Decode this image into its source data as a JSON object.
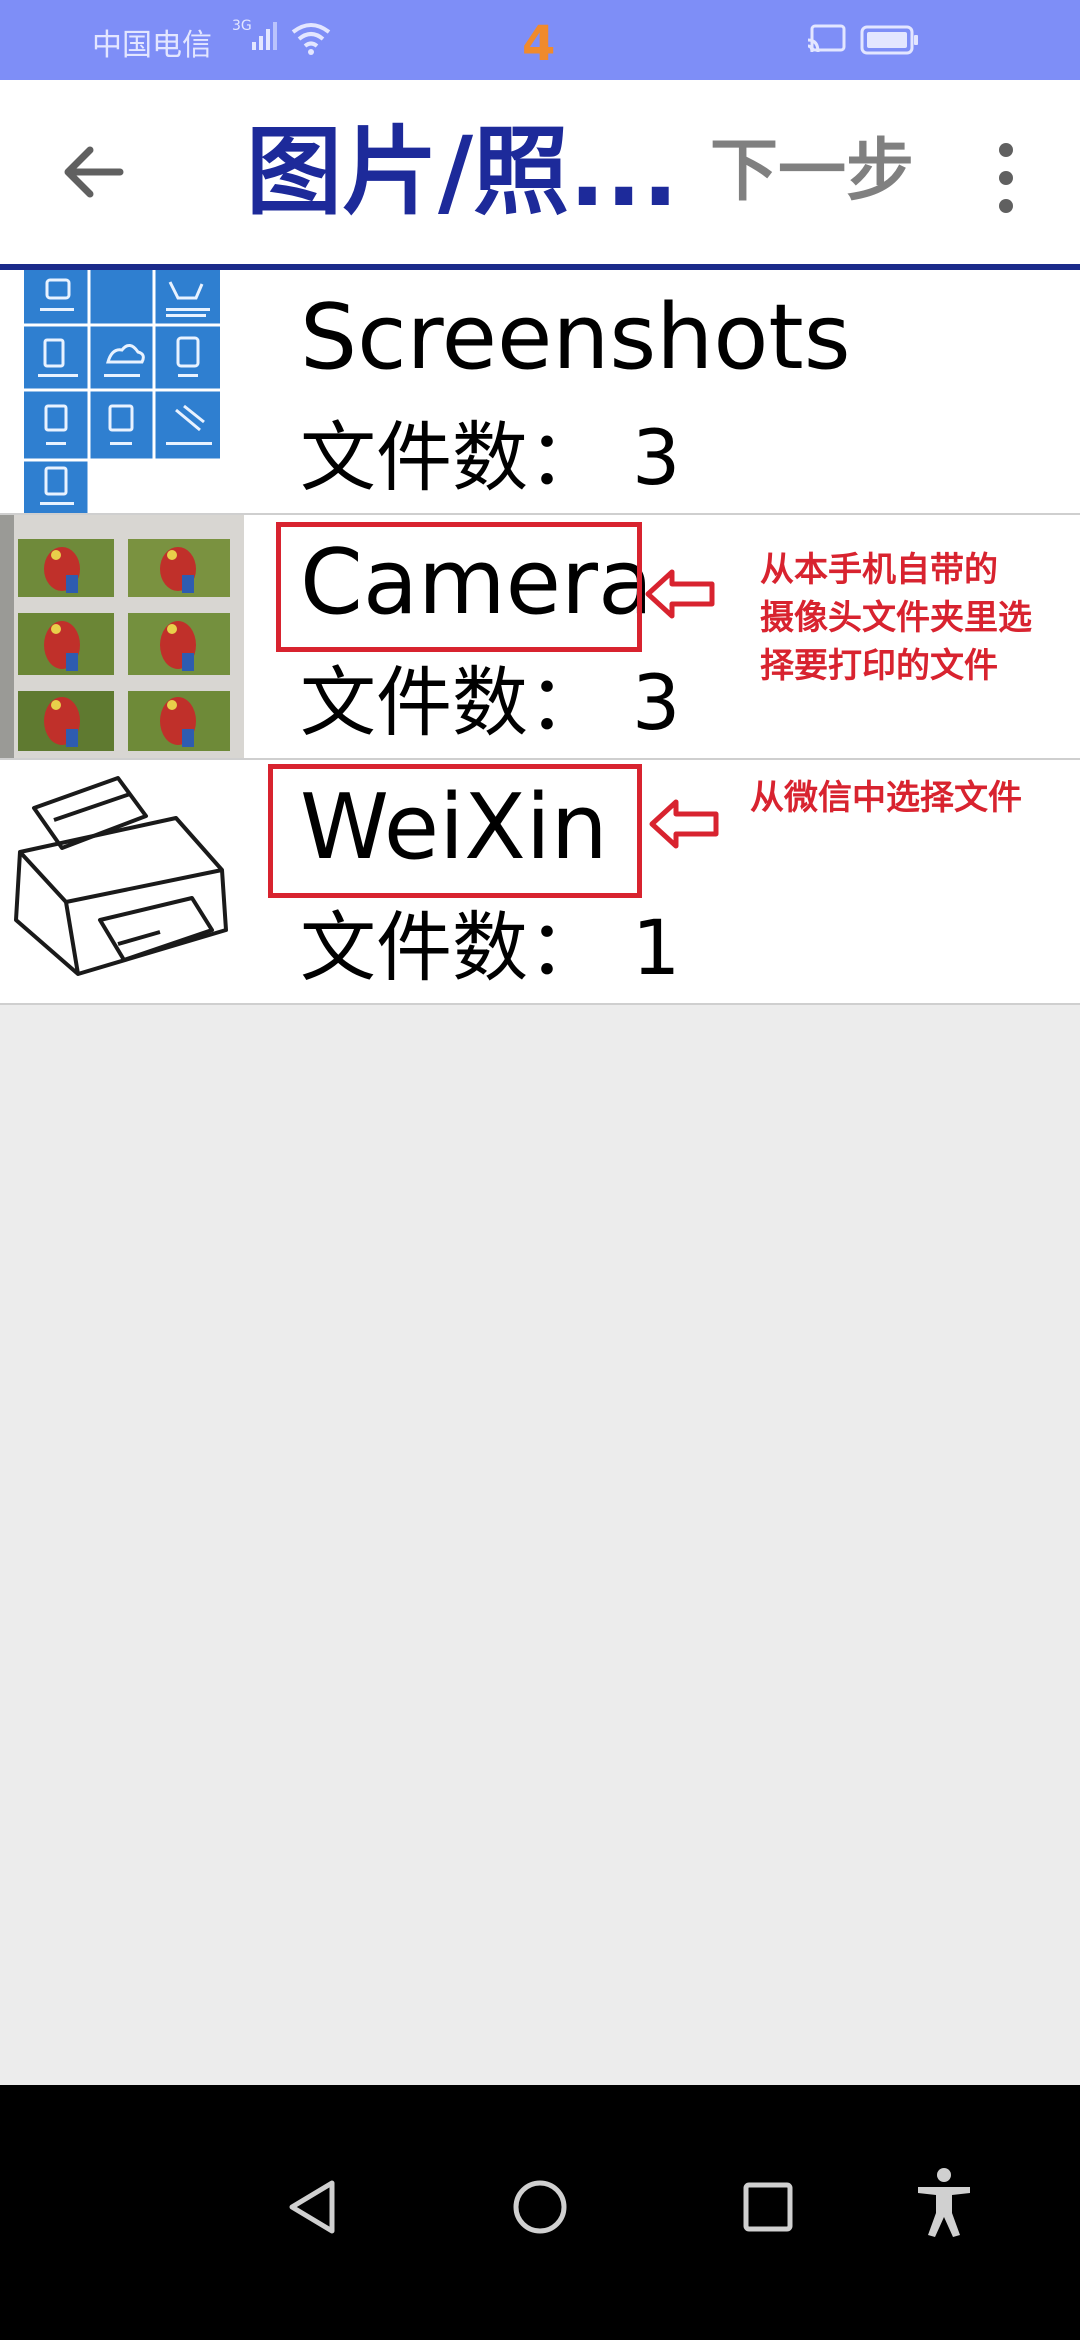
{
  "status_bar": {
    "carrier": "中国电信",
    "network": "3G",
    "step_number": "4",
    "icons": [
      "signal-icon",
      "wifi-icon",
      "cast-icon",
      "battery-icon"
    ]
  },
  "app_bar": {
    "back_icon": "arrow-left-icon",
    "title": "图片/照...",
    "next_label": "下一步",
    "more_icon": "more-vertical-icon"
  },
  "folders": [
    {
      "name": "Screenshots",
      "count_label": "文件数：",
      "count": "3",
      "thumbnail": "screenshot-grid"
    },
    {
      "name": "Camera",
      "count_label": "文件数：",
      "count": "3",
      "thumbnail": "parrot-photos"
    },
    {
      "name": "WeiXin",
      "count_label": "文件数：",
      "count": "1",
      "thumbnail": "printer-drawing"
    }
  ],
  "annotations": {
    "camera_note": [
      "从本手机自带的",
      "摄像头文件夹里选",
      "择要打印的文件"
    ],
    "weixin_note": "从微信中选择文件",
    "color": "#d8232f"
  },
  "nav_bar": {
    "icons": [
      "back-triangle-icon",
      "home-circle-icon",
      "recents-square-icon",
      "accessibility-icon"
    ]
  },
  "colors": {
    "status_bar": "#7e8ef7",
    "title": "#1d2a9a",
    "step_number": "#f08a2c",
    "next": "#808080"
  }
}
